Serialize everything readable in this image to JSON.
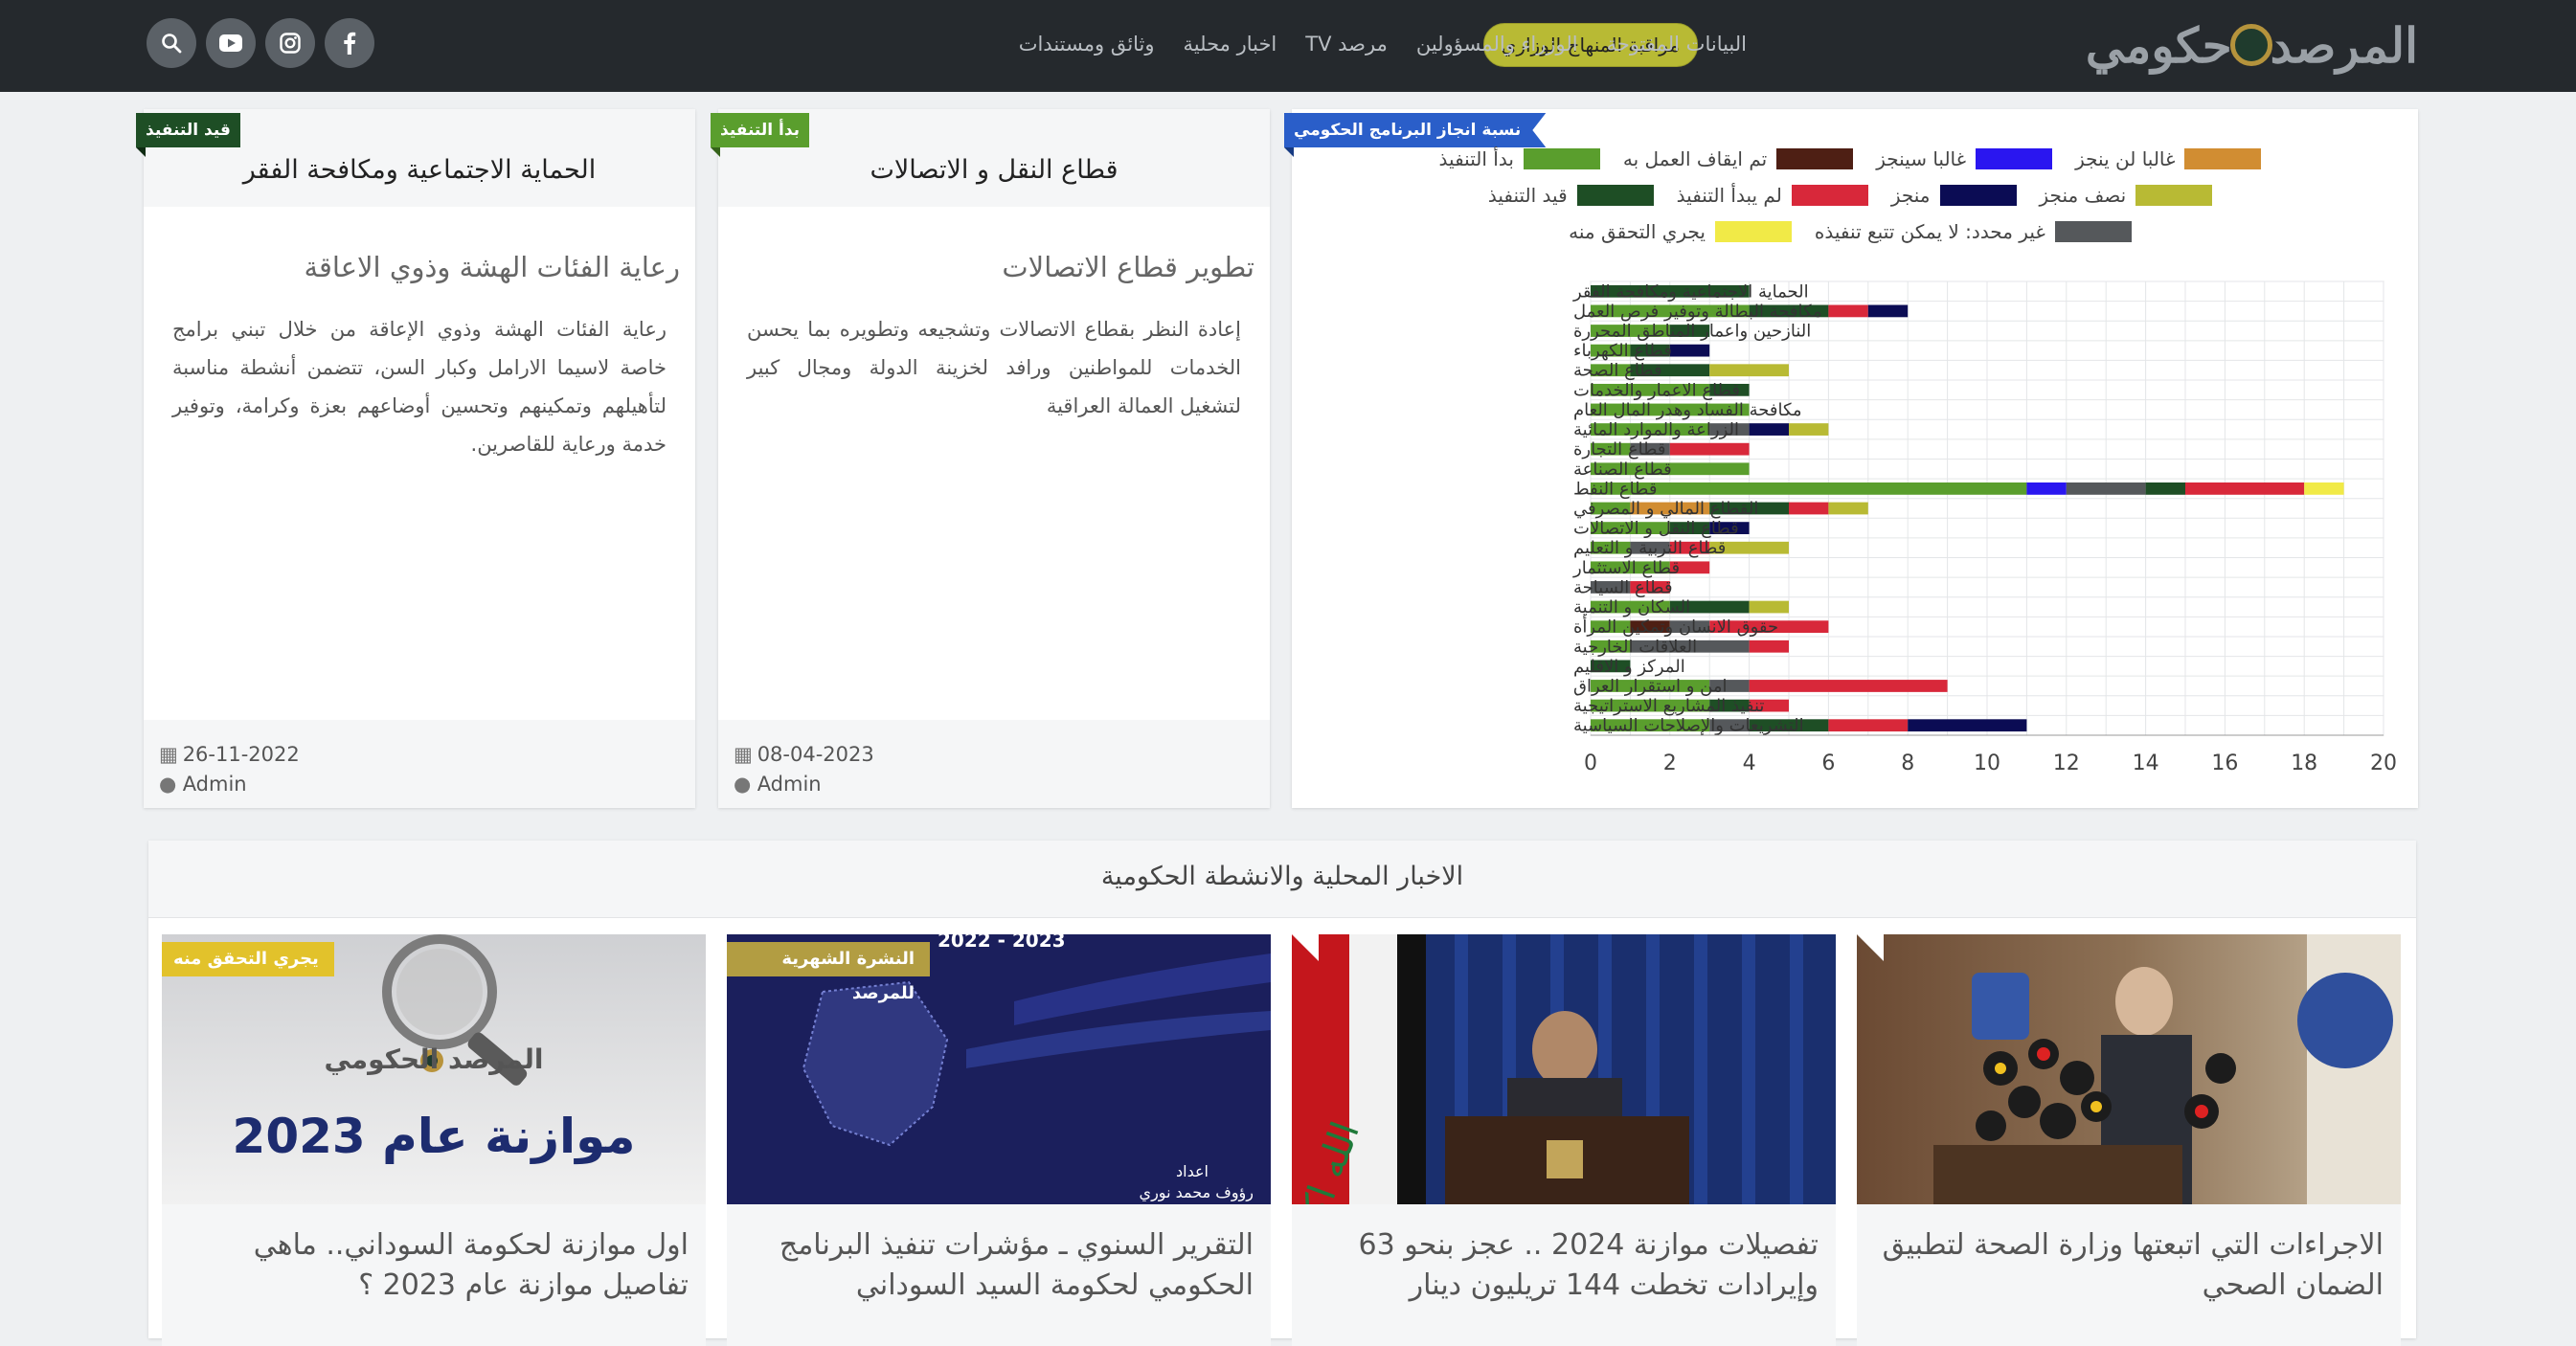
{
  "navbar": {
    "logo_part1": "المرصد",
    "logo_part2": "حكومي",
    "highlight_link": "مراقبة المنهاج الوزاري",
    "links": [
      "البيانات المفتوحة",
      "الوزراء والمسؤولين",
      "مرصد TV",
      "اخبار محلية",
      "وثائق ومستندات"
    ],
    "social_icons": [
      "facebook-icon",
      "instagram-icon",
      "youtube-icon",
      "search-icon"
    ]
  },
  "cards": [
    {
      "badge": "بدأ التنفيذ",
      "badge_color": "#5a9e2d",
      "title": "قطاع النقل و الاتصالات",
      "subtitle": "تطوير قطاع الاتصالات",
      "body": "إعادة النظر بقطاع الاتصالات وتشجيعه وتطويره بما يحسن الخدمات للمواطنين ورافد لخزينة الدولة ومجال كبير لتشغيل العمالة العراقية",
      "date": "08-04-2023",
      "author": "Admin"
    },
    {
      "badge": "قيد التنفيذ",
      "badge_color": "#1e4e25",
      "title": "الحماية الاجتماعية ومكافحة الفقر",
      "subtitle": "رعاية الفئات الهشة وذوي الاعاقة",
      "body": "رعاية الفئات الهشة وذوي الإعاقة من خلال تبني برامج خاصة لاسيما الارامل وكبار السن، تتضمن أنشطة مناسبة لتأهيلهم وتمكينهم وتحسين أوضاعهم بعزة وكرامة، وتوفير خدمة ورعاية للقاصرين.",
      "date": "26-11-2022",
      "author": "Admin"
    }
  ],
  "chart_badge": "نسبة انجاز البرنامج الحكومي",
  "chart_data": {
    "type": "bar",
    "orientation": "horizontal",
    "stacked": true,
    "xlim": [
      0,
      20
    ],
    "xticks": [
      0,
      2,
      4,
      6,
      8,
      10,
      12,
      14,
      16,
      18,
      20
    ],
    "grid": true,
    "legend_position": "top",
    "legend_order": [
      "غالبا لن ينجز",
      "غالبا سينجز",
      "تم ايقاف العمل به",
      "بدأ التنفيذ",
      "نصف منجز",
      "منجز",
      "لم يبدأ التنفيذ",
      "قيد التنفيذ",
      "غير محدد: لا يمكن تتبع تنفيذه",
      "يجري التحقق منه"
    ],
    "categories": [
      "الحماية الاجتماعية ومكافحة الفقر",
      "مكافحة البطالة وتوفير فرص العمل",
      "النازحين واعمار المناطق المحررة",
      "قطاع الكهرباء",
      "قطاع الصحة",
      "قطاع الاعمار والخدمات",
      "مكافحة الفساد وهدر المال العام",
      "الزراعة والموارد المائية",
      "قطاع التجارة",
      "قطاع الصناعة",
      "قطاع النفط",
      "القطاع المالي و المصرفي",
      "قطاع النقل و الاتصالات",
      "قطاع التربية و التعليم",
      "قطاع الاستثمار",
      "قطاع السياحة",
      "السكان و التنمية",
      "حقوق الانسان وتمكين المرأة",
      "العلاقات الخارجية",
      "المركز و الاقليم",
      "امن و استقرار العراق",
      "تنفيذ المشاريع الاستراتيجية",
      "التشريعات والإصلاحات السياسية"
    ],
    "series": [
      {
        "name": "بدأ التنفيذ",
        "color": "#5a9e2d",
        "values": [
          0,
          4,
          2,
          1,
          1,
          3,
          4,
          3,
          1,
          4,
          11,
          1,
          2,
          1,
          2,
          0,
          2,
          1,
          1,
          0,
          3,
          3,
          3
        ]
      },
      {
        "name": "تم ايقاف العمل به",
        "color": "#4e1f14",
        "values": [
          0,
          0,
          0,
          0,
          0,
          0,
          0,
          0,
          0,
          0,
          0,
          0,
          0,
          0,
          0,
          0,
          0,
          1,
          0,
          0,
          0,
          0,
          0
        ]
      },
      {
        "name": "غالبا لن ينجز",
        "color": "#d18d32",
        "values": [
          0,
          0,
          0,
          0,
          0,
          0,
          0,
          0,
          0,
          0,
          0,
          2,
          0,
          0,
          0,
          0,
          0,
          0,
          0,
          0,
          0,
          0,
          0
        ]
      },
      {
        "name": "غالبا سينجز",
        "color": "#2a16f0",
        "values": [
          0,
          0,
          0,
          0,
          0,
          0,
          0,
          0,
          0,
          0,
          1,
          0,
          0,
          0,
          0,
          0,
          0,
          0,
          0,
          0,
          0,
          0,
          0
        ]
      },
      {
        "name": "غير محدد: لا يمكن تتبع تنفيذه",
        "color": "#55585b",
        "values": [
          0,
          0,
          0,
          0,
          0,
          0,
          0,
          1,
          1,
          0,
          2,
          0,
          0,
          1,
          0,
          1,
          0,
          1,
          3,
          0,
          1,
          0,
          1
        ]
      },
      {
        "name": "قيد التنفيذ",
        "color": "#1e4e25",
        "values": [
          4,
          2,
          1,
          1,
          2,
          1,
          0,
          0,
          0,
          0,
          1,
          2,
          1,
          0,
          0,
          0,
          2,
          0,
          0,
          1,
          0,
          1,
          2
        ]
      },
      {
        "name": "لم يبدأ التنفيذ",
        "color": "#d8283a",
        "values": [
          0,
          1,
          0,
          0,
          0,
          0,
          0,
          0,
          2,
          0,
          3,
          1,
          0,
          1,
          1,
          1,
          0,
          3,
          1,
          0,
          5,
          1,
          2
        ]
      },
      {
        "name": "منجز",
        "color": "#0b0c54",
        "values": [
          0,
          1,
          0,
          1,
          0,
          0,
          0,
          1,
          0,
          0,
          0,
          0,
          1,
          0,
          0,
          0,
          0,
          0,
          0,
          0,
          0,
          0,
          3
        ]
      },
      {
        "name": "نصف منجز",
        "color": "#b8ba34",
        "values": [
          0,
          0,
          0,
          0,
          2,
          0,
          0,
          1,
          0,
          0,
          0,
          1,
          0,
          2,
          0,
          0,
          1,
          0,
          0,
          0,
          0,
          0,
          0
        ]
      },
      {
        "name": "يجري التحقق منه",
        "color": "#f1ea47",
        "values": [
          0,
          0,
          0,
          0,
          0,
          0,
          0,
          0,
          0,
          0,
          1,
          0,
          0,
          0,
          0,
          0,
          0,
          0,
          0,
          0,
          0,
          0,
          0
        ]
      }
    ]
  },
  "news": {
    "section_title": "الاخبار المحلية والانشطة الحكومية",
    "items": [
      {
        "title": "الاجراءات التي اتبعتها وزارة الصحة لتطبيق الضمان الصحي",
        "badge": ""
      },
      {
        "title": "تفصيلات موازنة 2024 .. عجز بنحو 63 وإيرادات تخطت 144 تريليون دينار",
        "badge": ""
      },
      {
        "title": "التقرير السنوي ـ مؤشرات تنفيذ البرنامج الحكومي لحكومة السيد السوداني",
        "badge": "النشرة الشهرية للمرصد",
        "img_text_top": "2022 - 2023",
        "img_text_credit1": "اعداد",
        "img_text_credit2": "رؤوف محمد نوري"
      },
      {
        "title": "اول موازنة لحكومة السوداني.. ماهي تفاصيل موازنة عام 2023 ؟",
        "badge": "يجري التحقق منه",
        "img_headline": "موازنة عام 2023",
        "img_logo": "المرصد الحكومي"
      }
    ]
  },
  "colors": {
    "navbar_bg": "#25292d",
    "accent": "#b8ba34",
    "page_bg": "#eef0f2"
  }
}
